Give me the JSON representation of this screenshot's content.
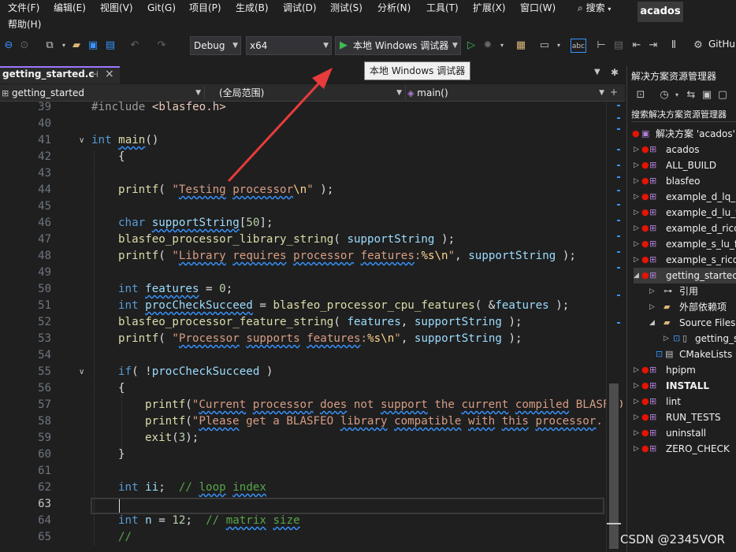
{
  "menu": {
    "items": [
      "文件(F)",
      "编辑(E)",
      "视图(V)",
      "Git(G)",
      "项目(P)",
      "生成(B)",
      "调试(D)",
      "测试(S)",
      "分析(N)",
      "工具(T)",
      "扩展(X)",
      "窗口(W)"
    ],
    "help": "帮助(H)",
    "search": "搜索",
    "solution_name": "acados"
  },
  "toolbar": {
    "config": "Debug",
    "platform": "x64",
    "run_label": "本地 Windows 调试器",
    "github": "GitHu"
  },
  "tooltip": "本地 Windows 调试器",
  "editor_tab": {
    "filename": "getting_started.c"
  },
  "navbar": {
    "project": "getting_started",
    "scope": "(全局范围)",
    "member": "main()"
  },
  "code": {
    "line_numbers": [
      "39",
      "40",
      "41",
      "42",
      "43",
      "44",
      "45",
      "46",
      "47",
      "48",
      "49",
      "50",
      "51",
      "52",
      "53",
      "54",
      "55",
      "56",
      "57",
      "58",
      "59",
      "60",
      "61",
      "62",
      "63",
      "64",
      "65"
    ],
    "current_line": "63"
  },
  "solution_explorer": {
    "title": "解决方案资源管理器",
    "search_placeholder": "搜索解决方案资源管理器",
    "solution_label": "解决方案 'acados'",
    "projects": [
      "acados",
      "ALL_BUILD",
      "blasfeo",
      "example_d_lq_",
      "example_d_lu_f",
      "example_d_ricc",
      "example_s_lu_f",
      "example_s_ricc",
      "getting_startec"
    ],
    "children": [
      "引用",
      "外部依赖项",
      "Source Files",
      "getting_s",
      "CMakeLists"
    ],
    "projects_after": [
      "hpipm",
      "INSTALL",
      "lint",
      "RUN_TESTS",
      "uninstall",
      "ZERO_CHECK"
    ]
  },
  "watermark": "CSDN @2345VOR",
  "colors": {
    "background": "#1f1f1f",
    "accent": "#9a76ff",
    "keyword": "#569cd6",
    "string": "#d69d85",
    "comment": "#57a64a",
    "arrow": "#e83b3b"
  }
}
